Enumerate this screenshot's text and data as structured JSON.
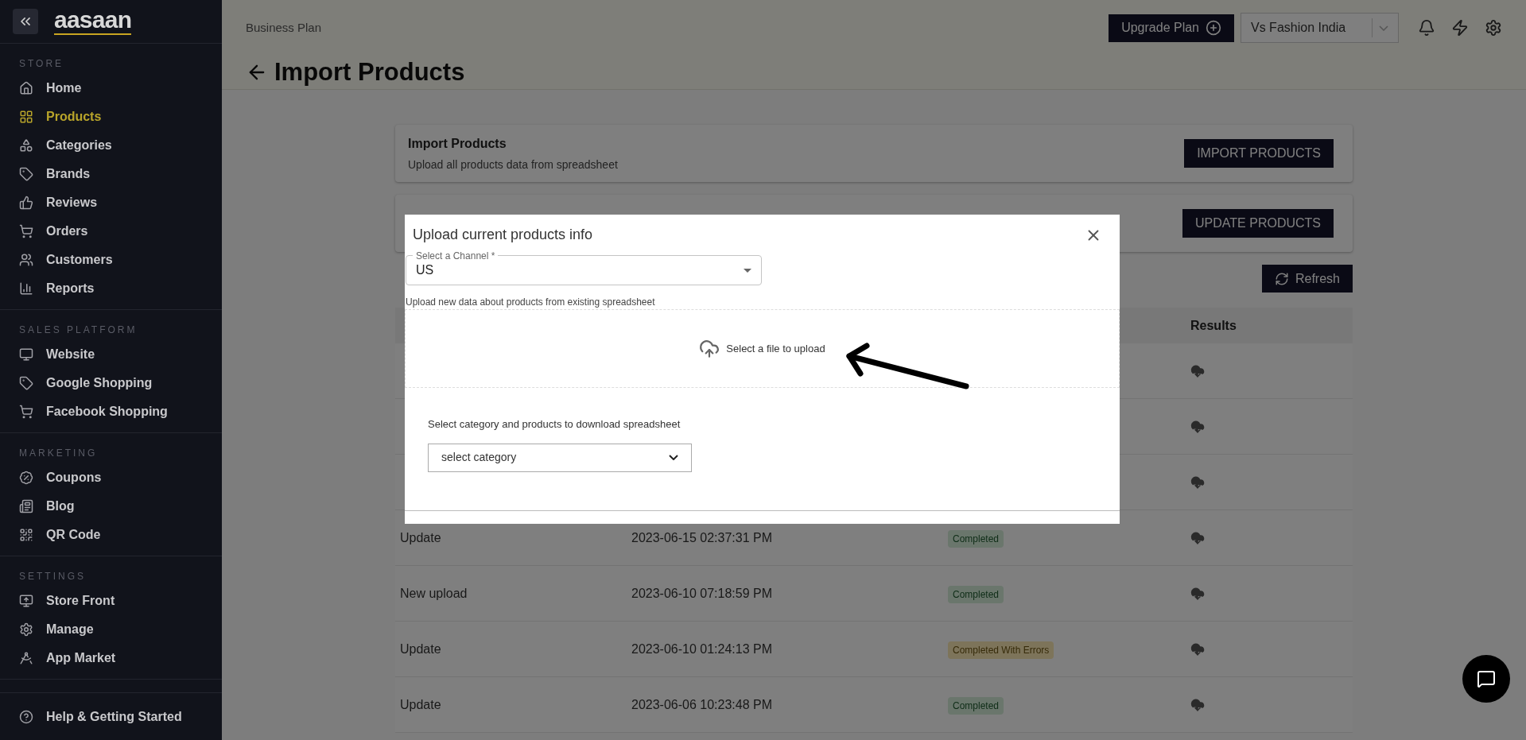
{
  "sidebar": {
    "logo": "aasaan",
    "sections": [
      {
        "title": "STORE",
        "items": [
          {
            "label": "Home",
            "selected": false
          },
          {
            "label": "Products",
            "selected": true
          },
          {
            "label": "Categories",
            "selected": false
          },
          {
            "label": "Brands",
            "selected": false
          },
          {
            "label": "Reviews",
            "selected": false
          },
          {
            "label": "Orders",
            "selected": false
          },
          {
            "label": "Customers",
            "selected": false
          },
          {
            "label": "Reports",
            "selected": false
          }
        ]
      },
      {
        "title": "SALES PLATFORM",
        "items": [
          {
            "label": "Website",
            "selected": false
          },
          {
            "label": "Google Shopping",
            "selected": false
          },
          {
            "label": "Facebook Shopping",
            "selected": false
          }
        ]
      },
      {
        "title": "MARKETING",
        "items": [
          {
            "label": "Coupons",
            "selected": false
          },
          {
            "label": "Blog",
            "selected": false
          },
          {
            "label": "QR Code",
            "selected": false
          }
        ]
      },
      {
        "title": "SETTINGS",
        "items": [
          {
            "label": "Store Front",
            "selected": false
          },
          {
            "label": "Manage",
            "selected": false
          },
          {
            "label": "App Market",
            "selected": false
          }
        ]
      }
    ],
    "help": "Help & Getting Started"
  },
  "topbar": {
    "plan": "Business Plan",
    "upgrade": "Upgrade Plan",
    "store": "Vs Fashion India"
  },
  "page": {
    "title": "Import Products"
  },
  "cards": [
    {
      "title": "Import Products",
      "subtitle": "Upload all products data from spreadsheet",
      "button": "IMPORT PRODUCTS"
    },
    {
      "button": "UPDATE PRODUCTS"
    }
  ],
  "refresh": "Refresh",
  "table": {
    "columns": [
      "Results"
    ],
    "rows": [
      {},
      {},
      {},
      {
        "type": "Update",
        "date": "2023-06-15 02:37:31 PM",
        "status": {
          "text": "Completed",
          "kind": "success"
        }
      },
      {
        "type": "New upload",
        "date": "2023-06-10 07:18:59 PM",
        "status": {
          "text": "Completed",
          "kind": "success"
        }
      },
      {
        "type": "Update",
        "date": "2023-06-10 01:24:13 PM",
        "status": {
          "text": "Completed With Errors",
          "kind": "warning"
        }
      },
      {
        "type": "Update",
        "date": "2023-06-06 10:23:48 PM",
        "status": {
          "text": "Completed",
          "kind": "success"
        }
      }
    ]
  },
  "modal": {
    "title": "Upload current products info",
    "channel": {
      "label": "Select a Channel *",
      "value": "US"
    },
    "help": "Upload new data about products from existing spreadsheet",
    "dropzone": "Select a file to upload",
    "category_label": "Select category and products to download spreadsheet",
    "category": {
      "placeholder": "select category"
    }
  }
}
